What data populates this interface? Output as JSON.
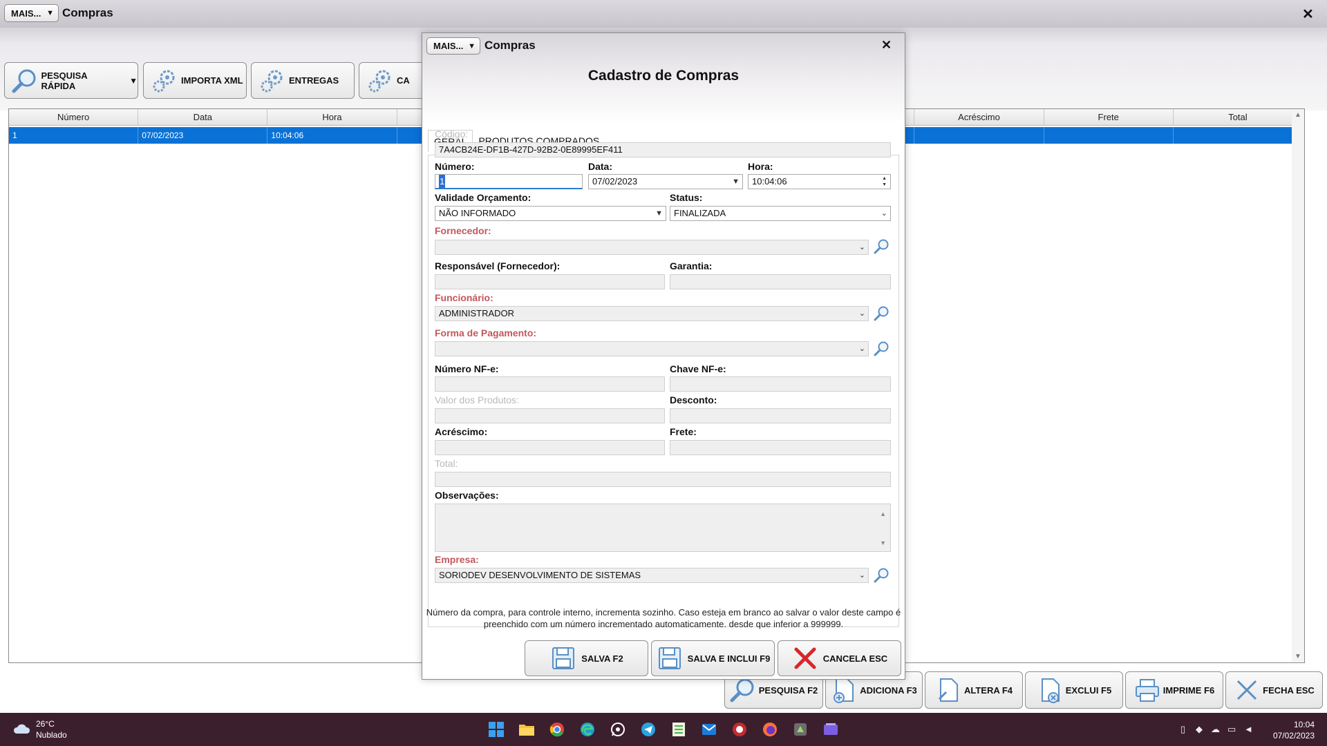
{
  "window": {
    "title": "Compras",
    "mais_label": "MAIS...",
    "close_label": "✕"
  },
  "toolbar": {
    "pesquisa_rapida": "PESQUISA RÁPIDA",
    "importa_xml": "IMPORTA XML",
    "entregas": "ENTREGAS",
    "partial": "CA"
  },
  "grid": {
    "columns": [
      "Número",
      "Data",
      "Hora",
      "",
      "",
      "",
      "",
      "Acréscimo",
      "Frete",
      "Total"
    ],
    "rows": [
      {
        "numero": "1",
        "data": "07/02/2023",
        "hora": "10:04:06"
      }
    ]
  },
  "bottom_buttons": {
    "pesquisa": "PESQUISA F2",
    "adiciona": "ADICIONA F3",
    "altera": "ALTERA F4",
    "exclui": "EXCLUI F5",
    "imprime": "IMPRIME F6",
    "fecha": "FECHA ESC"
  },
  "dialog": {
    "mais_label": "MAIS...",
    "title": "Compras",
    "close_label": "✕",
    "heading": "Cadastro de Compras",
    "tabs": [
      "GERAL",
      "PRODUTOS COMPRADOS"
    ],
    "labels": {
      "codigo": "Código:",
      "numero": "Número:",
      "data": "Data:",
      "hora": "Hora:",
      "validade": "Validade Orçamento:",
      "status": "Status:",
      "fornecedor": "Fornecedor:",
      "responsavel": "Responsável (Fornecedor):",
      "garantia": "Garantia:",
      "funcionario": "Funcionário:",
      "forma_pagamento": "Forma de Pagamento:",
      "numero_nfe": "Número NF-e:",
      "chave_nfe": "Chave NF-e:",
      "valor_produtos": "Valor dos Produtos:",
      "desconto": "Desconto:",
      "acrescimo": "Acréscimo:",
      "frete": "Frete:",
      "total": "Total:",
      "observacoes": "Observações:",
      "empresa": "Empresa:"
    },
    "values": {
      "codigo": "7A4CB24E-DF1B-427D-92B2-0E89995EF411",
      "numero": "1",
      "data": "07/02/2023",
      "hora": "10:04:06",
      "validade": "NÃO INFORMADO",
      "status": "FINALIZADA",
      "fornecedor": "",
      "responsavel": "",
      "garantia": "",
      "funcionario": "ADMINISTRADOR",
      "forma_pagamento": "",
      "numero_nfe": "",
      "chave_nfe": "",
      "valor_produtos": "",
      "desconto": "",
      "acrescimo": "",
      "frete": "",
      "total": "",
      "observacoes": "",
      "empresa": "SORIODEV DESENVOLVIMENTO DE SISTEMAS"
    },
    "hint_line1": "Número da compra, para controle interno, incrementa sozinho. Caso esteja em branco ao salvar o valor deste campo é",
    "hint_line2": "preenchido com um número incrementado automaticamente. desde que inferior a 999999.",
    "buttons": {
      "salva": "SALVA F2",
      "salva_inclui": "SALVA E INCLUI F9",
      "cancela": "CANCELA ESC"
    }
  },
  "taskbar": {
    "temperature": "26°C",
    "weather": "Nublado",
    "time": "10:04",
    "date": "07/02/2023",
    "apps": [
      "windows-start",
      "file-explorer",
      "chrome",
      "edge",
      "whatsapp",
      "telegram",
      "notepad",
      "outlook",
      "app-red",
      "firefox",
      "soriodev-app",
      "media-app"
    ]
  },
  "colors": {
    "selection": "#0a72d6",
    "required_label": "#c2575b",
    "taskbar": "#3c1f2d",
    "cancel_icon": "#d9262b"
  }
}
